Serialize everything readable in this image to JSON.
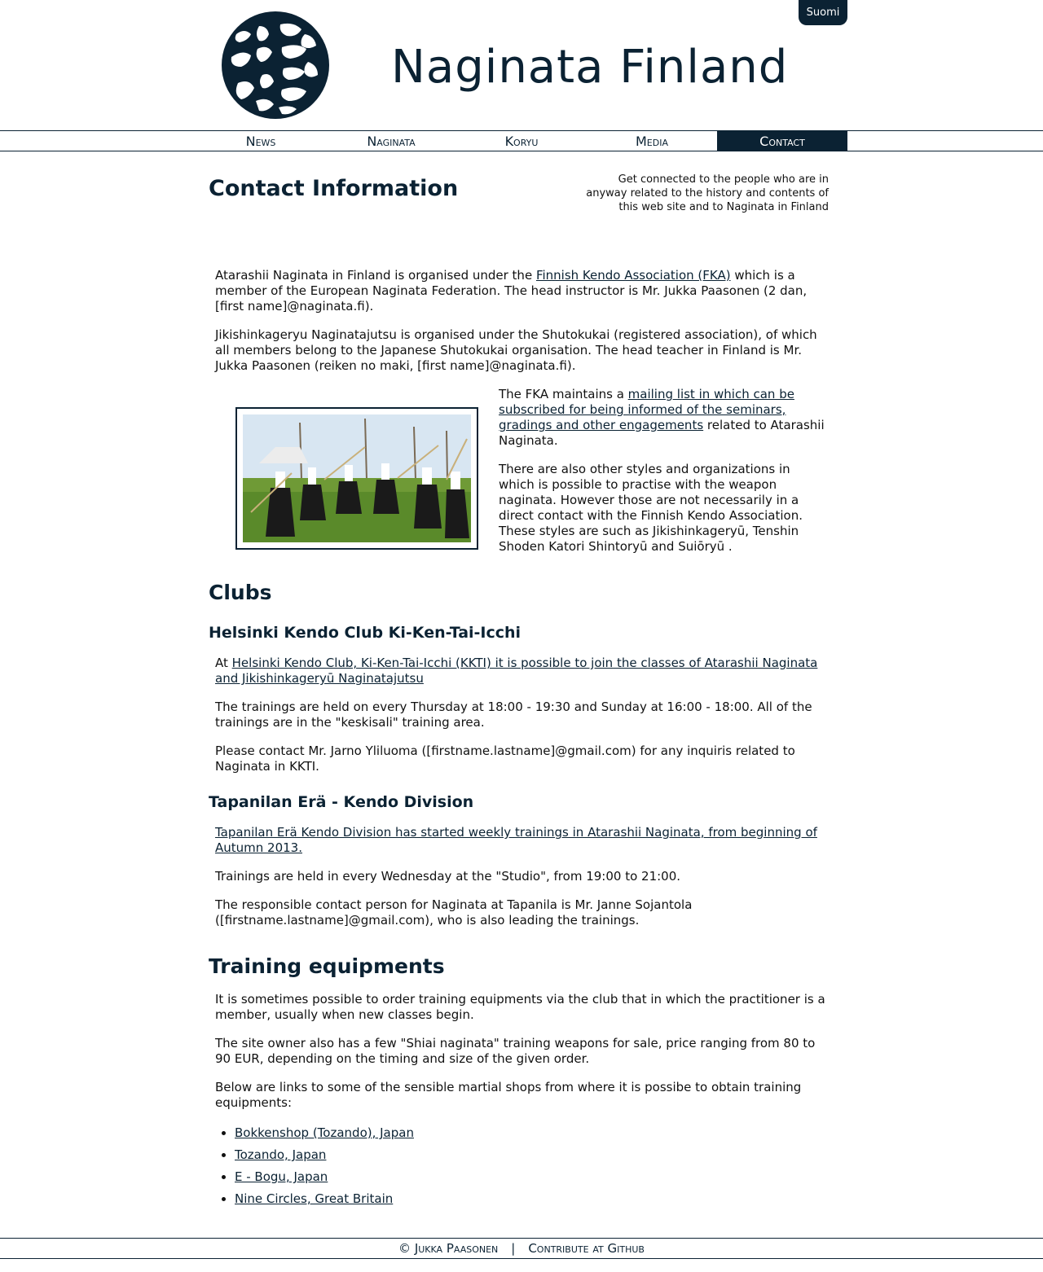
{
  "header": {
    "site_title": "Naginata Finland",
    "language_button": "Suomi"
  },
  "nav": {
    "items": [
      {
        "label": "News"
      },
      {
        "label": "Naginata"
      },
      {
        "label": "Koryu"
      },
      {
        "label": "Media"
      },
      {
        "label": "Contact"
      }
    ],
    "active_index": 4
  },
  "contact": {
    "title": "Contact Information",
    "description": "Get connected to the people who are in anyway related to the history and contents of this web site and to Naginata in Finland",
    "para1_prefix": "Atarashii Naginata in Finland is organised under the ",
    "para1_link": "Finnish Kendo Association (FKA)",
    "para1_suffix": " which is a member of the European Naginata Federation. The head instructor is Mr. Jukka Paasonen (2 dan, [first name]@naginata.fi).",
    "para2": "Jikishinkageryu Naginatajutsu is organised under the Shutokukai (registered association), of which all members belong to the Japanese Shutokukai organisation. The head teacher in Finland is Mr. Jukka Paasonen (reiken no maki, [first name]@naginata.fi).",
    "para3_prefix": "The FKA maintains a ",
    "para3_link": "mailing list in which can be subscribed for being informed of the seminars, gradings and other engagements",
    "para3_suffix": " related to Atarashii Naginata.",
    "para4": "There are also other styles and organizations in which is possible to practise with the weapon naginata. However those are not necessarily in a direct contact with the Finnish Kendo Association. These styles are such as Jikishinkageryū, Tenshin Shoden Katori Shintoryū and Suiōryū ."
  },
  "clubs": {
    "title": "Clubs",
    "kkti": {
      "title": "Helsinki Kendo Club Ki-Ken-Tai-Icchi",
      "p1_prefix": "At ",
      "p1_link": "Helsinki Kendo Club, Ki-Ken-Tai-Icchi (KKTI) it is possible to join the classes of Atarashii Naginata and Jikishinkageryū Naginatajutsu",
      "p2": "The trainings are held on every Thursday at 18:00 - 19:30 and Sunday at 16:00 - 18:00. All of the trainings are in the \"keskisali\" training area.",
      "p3": "Please contact Mr. Jarno Yliluoma ([firstname.lastname]@gmail.com) for any inquiris related to Naginata in KKTI."
    },
    "tapanila": {
      "title": "Tapanilan Erä - Kendo Division",
      "p1_link": "Tapanilan Erä Kendo Division has started weekly trainings in Atarashii Naginata, from beginning of Autumn 2013.",
      "p2": "Trainings are held in every Wednesday at the \"Studio\", from 19:00 to 21:00.",
      "p3": "The responsible contact person for Naginata at Tapanila is Mr. Janne Sojantola ([firstname.lastname]@gmail.com), who is also leading the trainings."
    }
  },
  "equipment": {
    "title": "Training equipments",
    "p1": "It is sometimes possible to order training equipments via the club that in which the practitioner is a member, usually when new classes begin.",
    "p2": "The site owner also has a few \"Shiai naginata\" training weapons for sale, price ranging from 80 to 90 EUR, depending on the timing and size of the given order.",
    "p3": "Below are links to some of the sensible martial shops from where it is possibe to obtain training equipments:",
    "shops": [
      "Bokkenshop (Tozando), Japan",
      "Tozando, Japan",
      "E - Bogu, Japan",
      "Nine Circles, Great Britain"
    ]
  },
  "footer": {
    "copyright": "© Jukka Paasonen",
    "separator": "|",
    "github": "Contribute at Github"
  },
  "colors": {
    "brand": "#0b2233",
    "text": "#111111",
    "background": "#ffffff"
  },
  "icons": {
    "logo": "kanji-seal-logo",
    "list_bullet": "disc"
  }
}
